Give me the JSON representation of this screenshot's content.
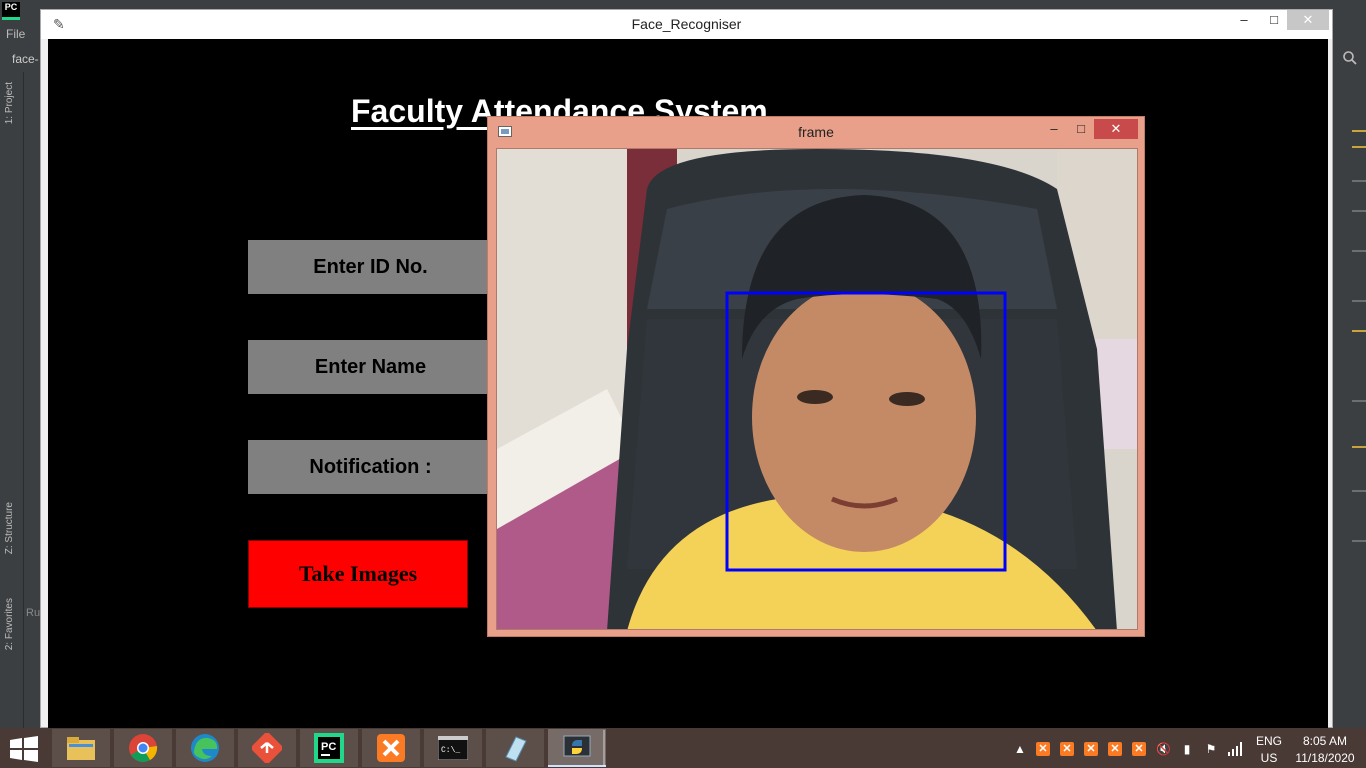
{
  "ide": {
    "logo_text": "PC",
    "menu_file": "File",
    "project_tab": "face-",
    "side_project": "1: Project",
    "side_structure": "Z: Structure",
    "side_favorites": "2: Favorites",
    "run_label": "Ru"
  },
  "tk_window": {
    "title": "Face_Recogniser",
    "minimize": "–",
    "maximize": "□",
    "close": "✕"
  },
  "app": {
    "heading": "Faculty Attendance System",
    "id_label": "Enter ID No.",
    "name_label": "Enter Name",
    "notification_label": "Notification :",
    "take_images_button": "Take Images"
  },
  "cv_window": {
    "title": "frame",
    "minimize": "–",
    "maximize": "□",
    "close": "✕",
    "face_box_color": "#0000ff"
  },
  "taskbar": {
    "apps": [
      "file-explorer",
      "chrome",
      "edge",
      "git-tool",
      "pycharm",
      "xampp",
      "command-prompt",
      "notes",
      "python"
    ],
    "language_line1": "ENG",
    "language_line2": "US",
    "time": "8:05 AM",
    "date": "11/18/2020"
  }
}
